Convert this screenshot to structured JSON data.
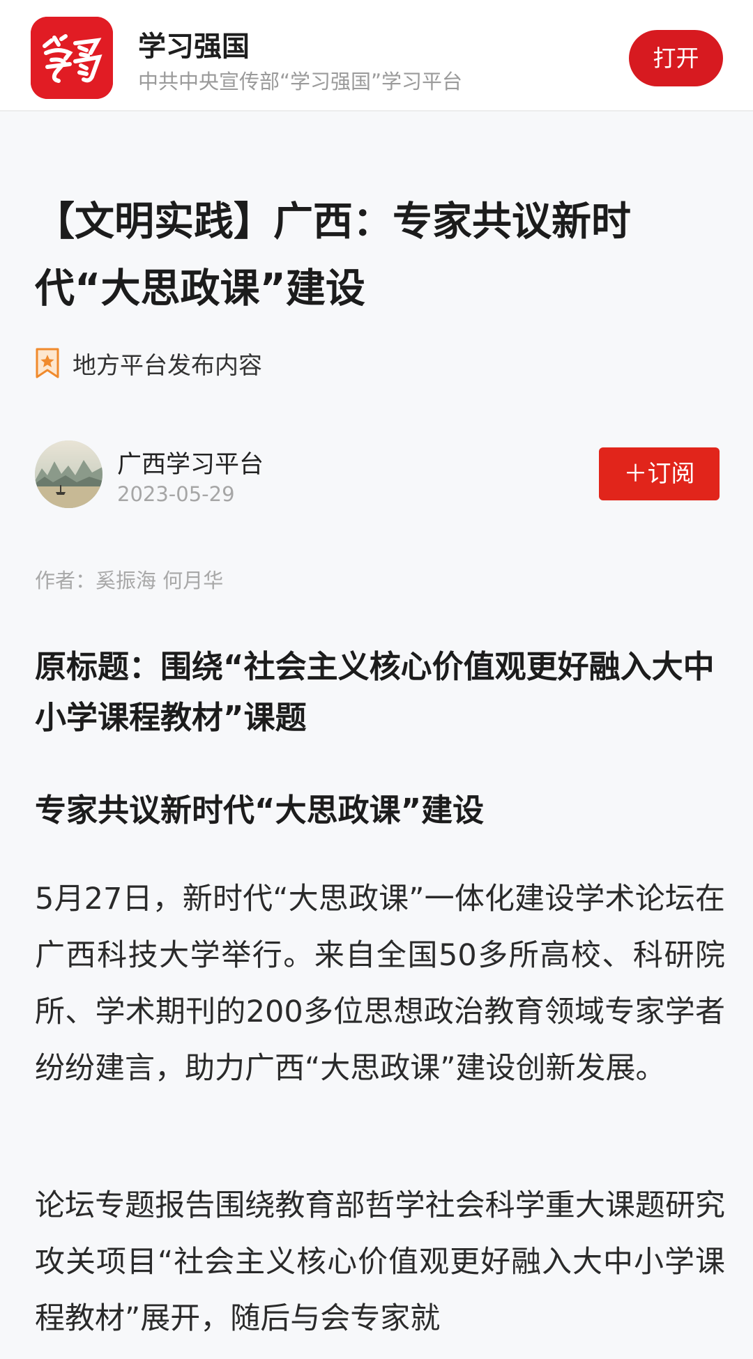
{
  "app_banner": {
    "name": "学习强国",
    "description": "中共中央宣传部“学习强国”学习平台",
    "open_label": "打开",
    "logo_text": "学习",
    "brand_color": "#e11c24"
  },
  "article": {
    "title": "【文明实践】广西：专家共议新时代“大思政课”建设",
    "badge": {
      "icon": "star-bookmark-icon",
      "label": "地方平台发布内容"
    },
    "publisher": {
      "name": "广西学习平台",
      "date": "2023-05-29",
      "subscribe_label": "＋订阅"
    },
    "author_line": "作者：奚振海 何月华",
    "original_title": "原标题：围绕“社会主义核心价值观更好融入大中小学课程教材”课题",
    "subtitle": "专家共议新时代“大思政课”建设",
    "paragraphs": [
      "5月27日，新时代“大思政课”一体化建设学术论坛在广西科技大学举行。来自全国50多所高校、科研院所、学术期刊的200多位思想政治教育领域专家学者纷纷建言，助力广西“大思政课”建设创新发展。",
      "论坛专题报告围绕教育部哲学社会科学重大课题研究攻关项目“社会主义核心价值观更好融入大中小学课程教材”展开，随后与会专家就"
    ]
  }
}
